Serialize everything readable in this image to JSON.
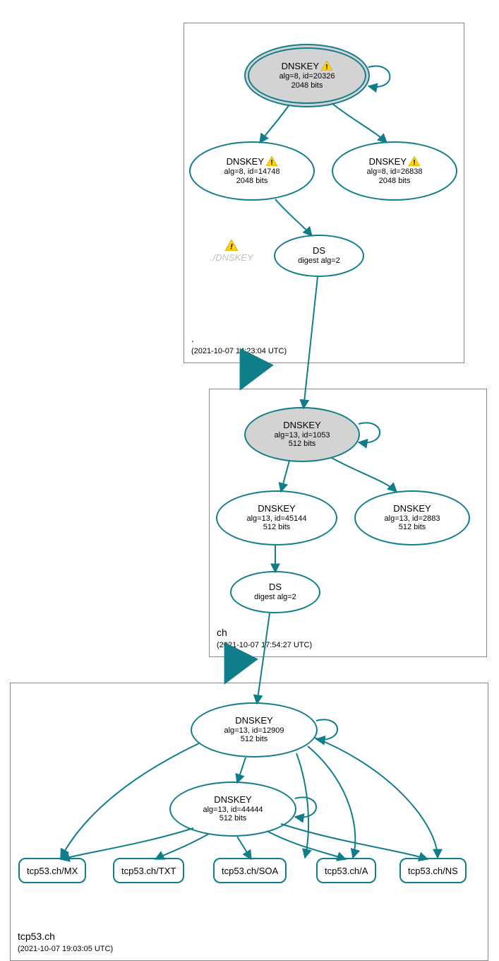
{
  "zones": {
    "root": {
      "name": ".",
      "timestamp": "(2021-10-07 14:23:04 UTC)"
    },
    "ch": {
      "name": "ch",
      "timestamp": "(2021-10-07 17:54:27 UTC)"
    },
    "tcp53": {
      "name": "tcp53.ch",
      "timestamp": "(2021-10-07 19:03:05 UTC)"
    }
  },
  "nodes": {
    "root_ksk": {
      "title": "DNSKEY",
      "line2": "alg=8, id=20326",
      "line3": "2048 bits",
      "warn": true
    },
    "root_zsk1": {
      "title": "DNSKEY",
      "line2": "alg=8, id=14748",
      "line3": "2048 bits",
      "warn": true
    },
    "root_zsk2": {
      "title": "DNSKEY",
      "line2": "alg=8, id=26838",
      "line3": "2048 bits",
      "warn": true
    },
    "root_ds": {
      "title": "DS",
      "line2": "digest alg=2"
    },
    "root_ghost": {
      "label": "./DNSKEY"
    },
    "ch_ksk": {
      "title": "DNSKEY",
      "line2": "alg=13, id=1053",
      "line3": "512 bits"
    },
    "ch_zsk1": {
      "title": "DNSKEY",
      "line2": "alg=13, id=45144",
      "line3": "512 bits"
    },
    "ch_zsk2": {
      "title": "DNSKEY",
      "line2": "alg=13, id=2883",
      "line3": "512 bits"
    },
    "ch_ds": {
      "title": "DS",
      "line2": "digest alg=2"
    },
    "t_ksk": {
      "title": "DNSKEY",
      "line2": "alg=13, id=12909",
      "line3": "512 bits"
    },
    "t_zsk": {
      "title": "DNSKEY",
      "line2": "alg=13, id=44444",
      "line3": "512 bits"
    },
    "rr_mx": {
      "label": "tcp53.ch/MX"
    },
    "rr_txt": {
      "label": "tcp53.ch/TXT"
    },
    "rr_soa": {
      "label": "tcp53.ch/SOA"
    },
    "rr_a": {
      "label": "tcp53.ch/A"
    },
    "rr_ns": {
      "label": "tcp53.ch/NS"
    }
  }
}
